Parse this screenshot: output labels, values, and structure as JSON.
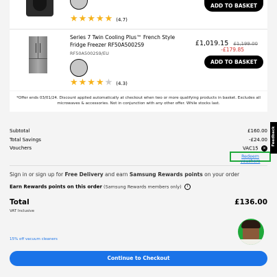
{
  "product1": {
    "rating": "(4.7)",
    "button": "ADD TO BASKET"
  },
  "product2": {
    "title": "Series 7 Twin Cooling Plus™ French Style Fridge Freezer RF50A5002S9",
    "model": "RF50A5002S9/EU",
    "price": "£1,019.15",
    "was_price": "£1,199.00",
    "saving": "-£179.85",
    "rating": "(4.3)",
    "button": "ADD TO BASKET"
  },
  "offer_note": "*Offer ends 03/01/24. Discount applied automatically at checkout when two or more qualifying products in basket. Excludes all microwaves & accessories. Not in conjunction with any other offer. While stocks last.",
  "summary": {
    "subtotal_label": "Subtotal",
    "subtotal_value": "£160.00",
    "savings_label": "Total Savings",
    "savings_value": "-£24.00",
    "vouchers_label": "Vouchers",
    "voucher_code": "VAC15",
    "redeem_link": "Redeem vouchers"
  },
  "feedback_tab": "Feedback",
  "signin": {
    "pre": "Sign in or sign up for ",
    "bold1": "Free Delivery",
    "mid": " and earn ",
    "bold2": "Samsung Rewards points",
    "post": " on your order"
  },
  "earn": {
    "bold": "Earn Rewards points on this order",
    "light": " (Samsung Rewards members only)"
  },
  "total": {
    "label": "Total",
    "value": "£136.00",
    "vat": "VAT Inclusive"
  },
  "promo_text": "15% off vacuum cleaners",
  "checkout_button": "Continue to Checkout",
  "colors": {
    "accent": "#1a73e8",
    "green_highlight": "#1fa83a",
    "sale_red": "#d6322d",
    "star": "#f6b21b"
  }
}
